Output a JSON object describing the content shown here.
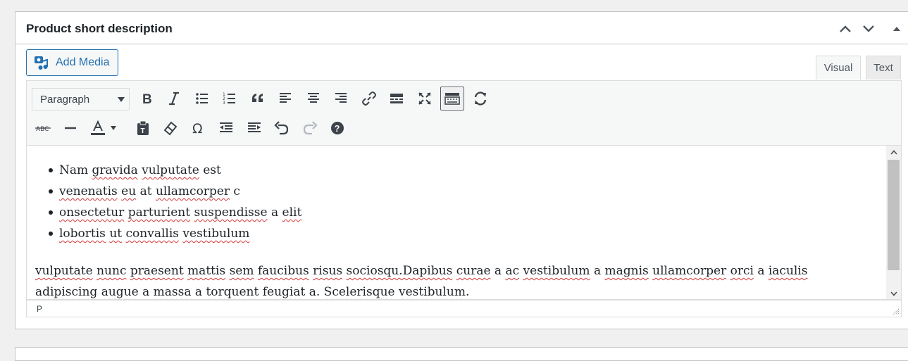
{
  "metabox": {
    "title": "Product short description"
  },
  "editor": {
    "add_media_label": "Add Media",
    "tabs": {
      "visual": "Visual",
      "text": "Text"
    },
    "format_select": "Paragraph",
    "toolbar_row1": [
      "bold",
      "italic",
      "bulleted-list",
      "numbered-list",
      "blockquote",
      "align-left",
      "align-center",
      "align-right",
      "insert-link",
      "read-more",
      "fullscreen",
      "toolbar-toggle",
      "sync"
    ],
    "toolbar_row2": [
      "strikethrough",
      "horizontal-line",
      "text-color",
      "paste-as-text",
      "clear-formatting",
      "special-character",
      "outdent",
      "indent",
      "undo",
      "redo",
      "keyboard-shortcuts"
    ],
    "content": {
      "list_items": [
        "Nam gravida vulputate est",
        "venenatis eu at ullamcorper c",
        "onsectetur parturient suspendisse a elit",
        "lobortis ut convallis vestibulum"
      ],
      "paragraph_line1": "vulputate nunc praesent mattis sem faucibus risus sociosqu.Dapibus curae a ac vestibulum a magnis ullamcorper orci a iaculis",
      "paragraph_line2": "adipiscing augue a massa a torquent feugiat a. Scelerisque vestibulum."
    },
    "status_path": "P"
  },
  "colors": {
    "accent": "#2271b1",
    "spellcheck": "#d63638",
    "border": "#c3c4c7"
  }
}
